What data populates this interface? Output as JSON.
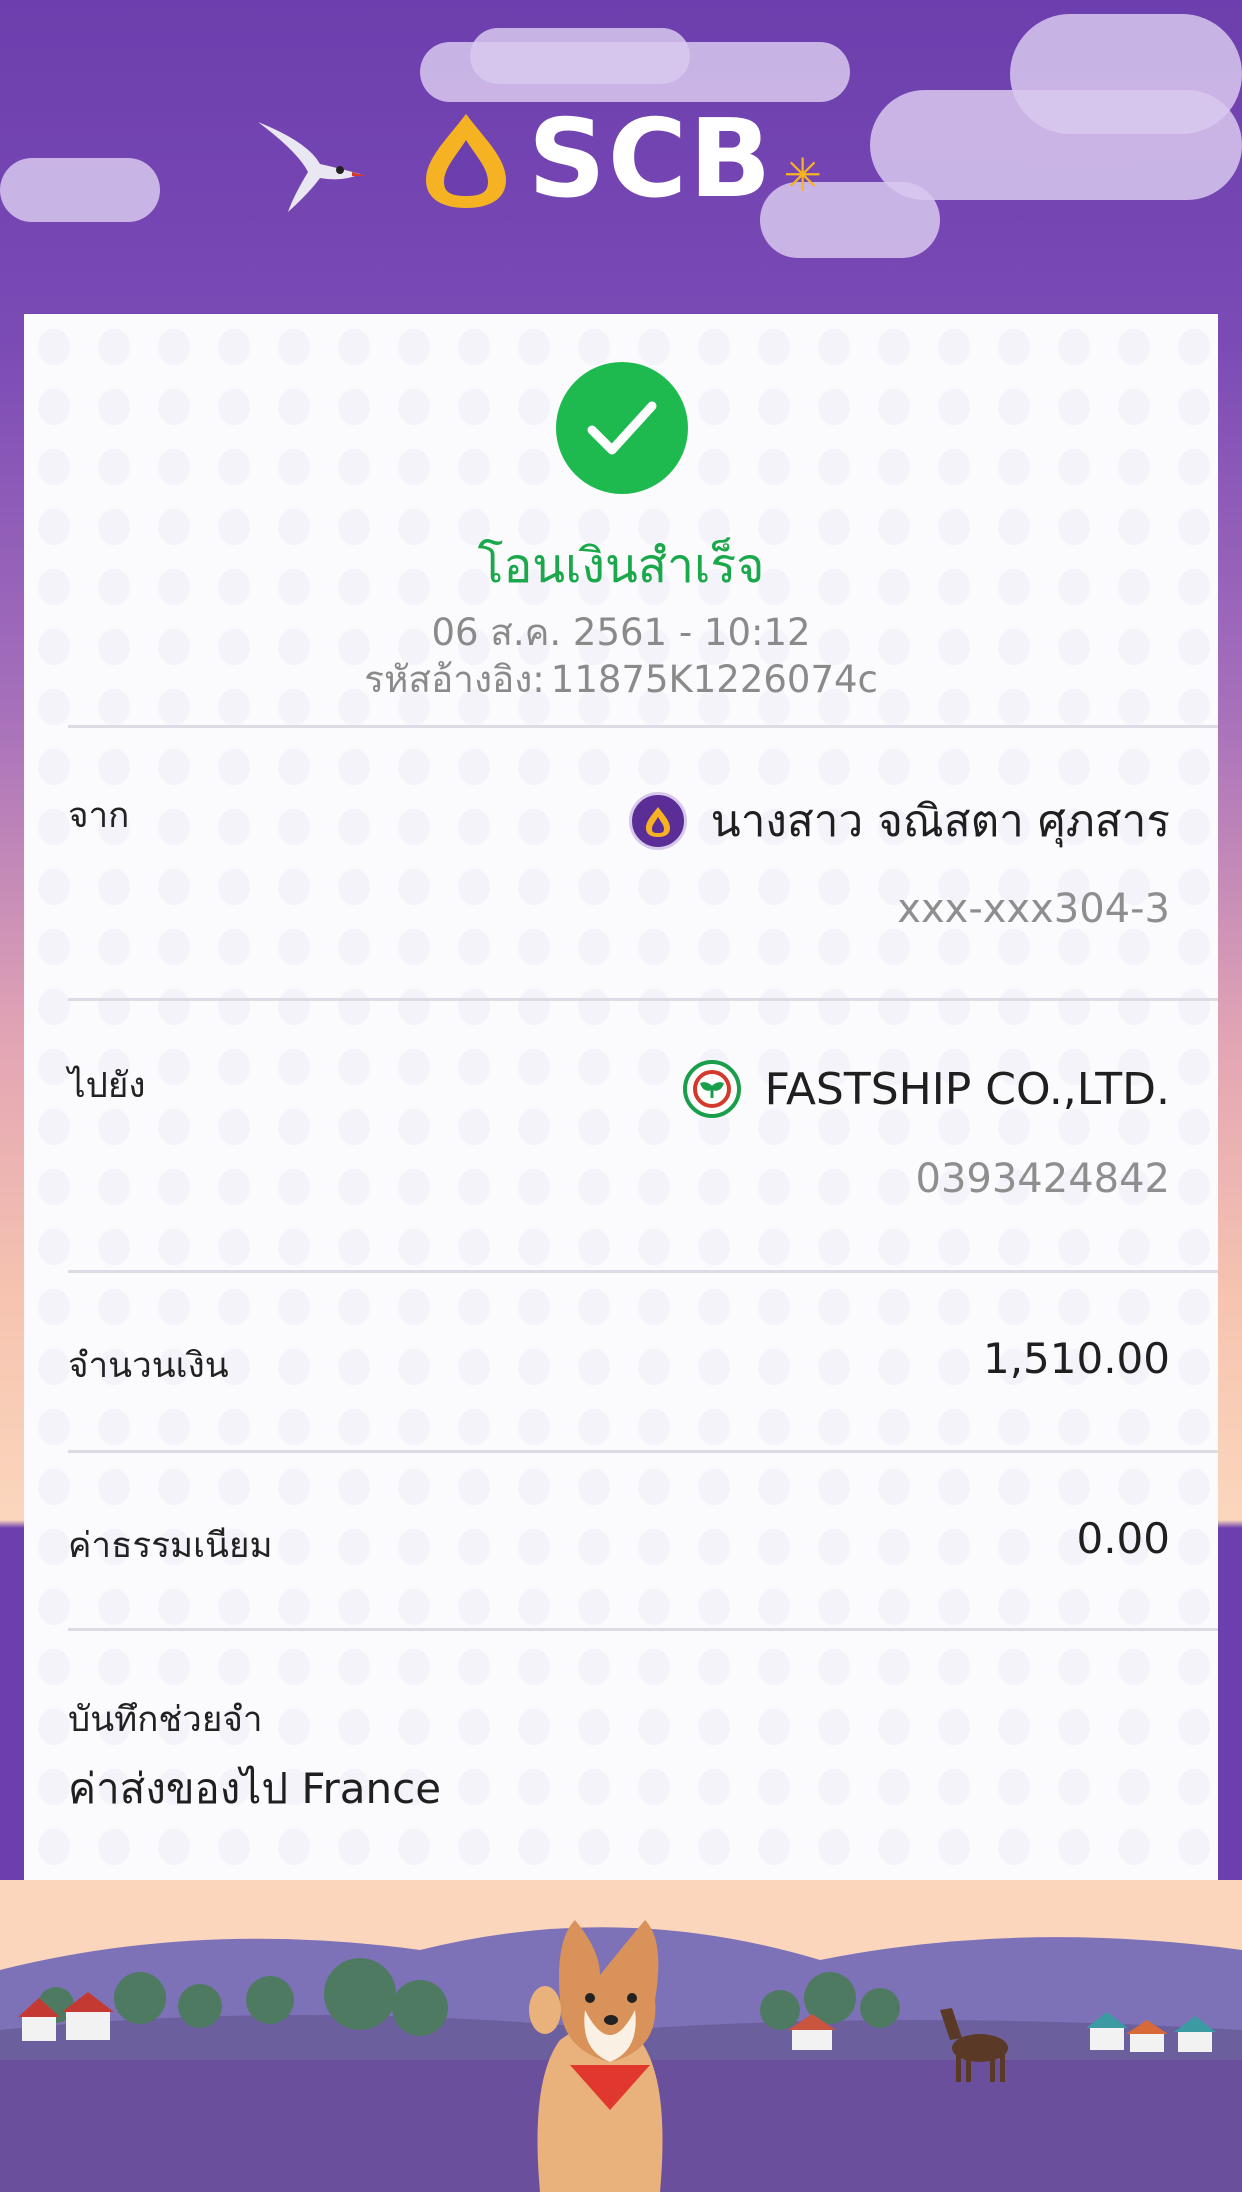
{
  "app": {
    "brand_name": "SCB",
    "colors": {
      "brand_purple": "#6c3fae",
      "brand_gold": "#f5b323",
      "success_green": "#1fba4f"
    }
  },
  "header": {
    "logo_text": "SCB",
    "logo_icon": "scb-logo-mark-icon",
    "decor": [
      "bird-icon",
      "cloud-icon"
    ]
  },
  "status": {
    "icon": "check-icon",
    "title": "โอนเงินสำเร็จ",
    "datetime": "06 ส.ค. 2561 - 10:12",
    "reference_label": "รหัสอ้างอิง:",
    "reference_value": "11875K1226074c"
  },
  "from": {
    "label": "จาก",
    "icon": "scb-bank-icon",
    "name": "นางสาว จณิสตา ศุภสาร",
    "account": "xxx-xxx304-3"
  },
  "to": {
    "label": "ไปยัง",
    "icon": "kbank-bank-icon",
    "name": "FASTSHIP CO.,LTD.",
    "account": "0393424842"
  },
  "amount": {
    "label": "จำนวนเงิน",
    "value": "1,510.00"
  },
  "fee": {
    "label": "ค่าธรรมเนียม",
    "value": "0.00"
  },
  "memo": {
    "label": "บันทึกช่วยจำ",
    "value": "ค่าส่งของไป France"
  },
  "footer": {
    "decor": [
      "shiba-dog-icon",
      "horse-icon",
      "house-icon",
      "tree-icon",
      "lavender-field-icon"
    ]
  }
}
